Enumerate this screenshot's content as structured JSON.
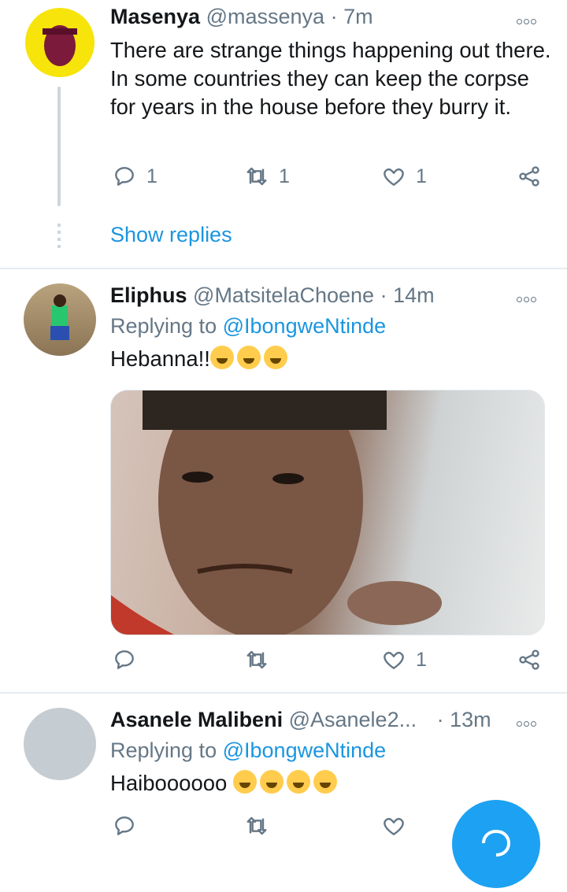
{
  "tweets": [
    {
      "name": "Masenya",
      "handle": "@massenya",
      "time": "· 7m",
      "text": "There are strange things happening out there. In some countries they can keep the corpse for years in the house before they burry it.",
      "replies": "1",
      "retweets": "1",
      "likes": "1",
      "show_replies": "Show replies"
    },
    {
      "name": "Eliphus",
      "handle": "@MatsitelaChoene",
      "time": "· 14m",
      "replying_prefix": "Replying to",
      "replying_to": "@IbongweNtinde",
      "text": "Hebanna!!",
      "emoji": [
        "face-with-tears-of-joy",
        "face-with-tears-of-joy",
        "face-with-tears-of-joy"
      ],
      "replies": "",
      "retweets": "",
      "likes": "1"
    },
    {
      "name": "Asanele Malibeni",
      "handle": "@Asanele2...",
      "time": "· 13m",
      "replying_prefix": "Replying to",
      "replying_to": "@IbongweNtinde",
      "text": "Haiboooooo",
      "emoji": [
        "loudly-crying-face",
        "loudly-crying-face",
        "loudly-crying-face",
        "loudly-crying-face"
      ],
      "replies": "",
      "retweets": "",
      "likes": ""
    }
  ],
  "colors": {
    "accent": "#1b95e0",
    "muted": "#657786",
    "fab": "#1da1f2"
  }
}
